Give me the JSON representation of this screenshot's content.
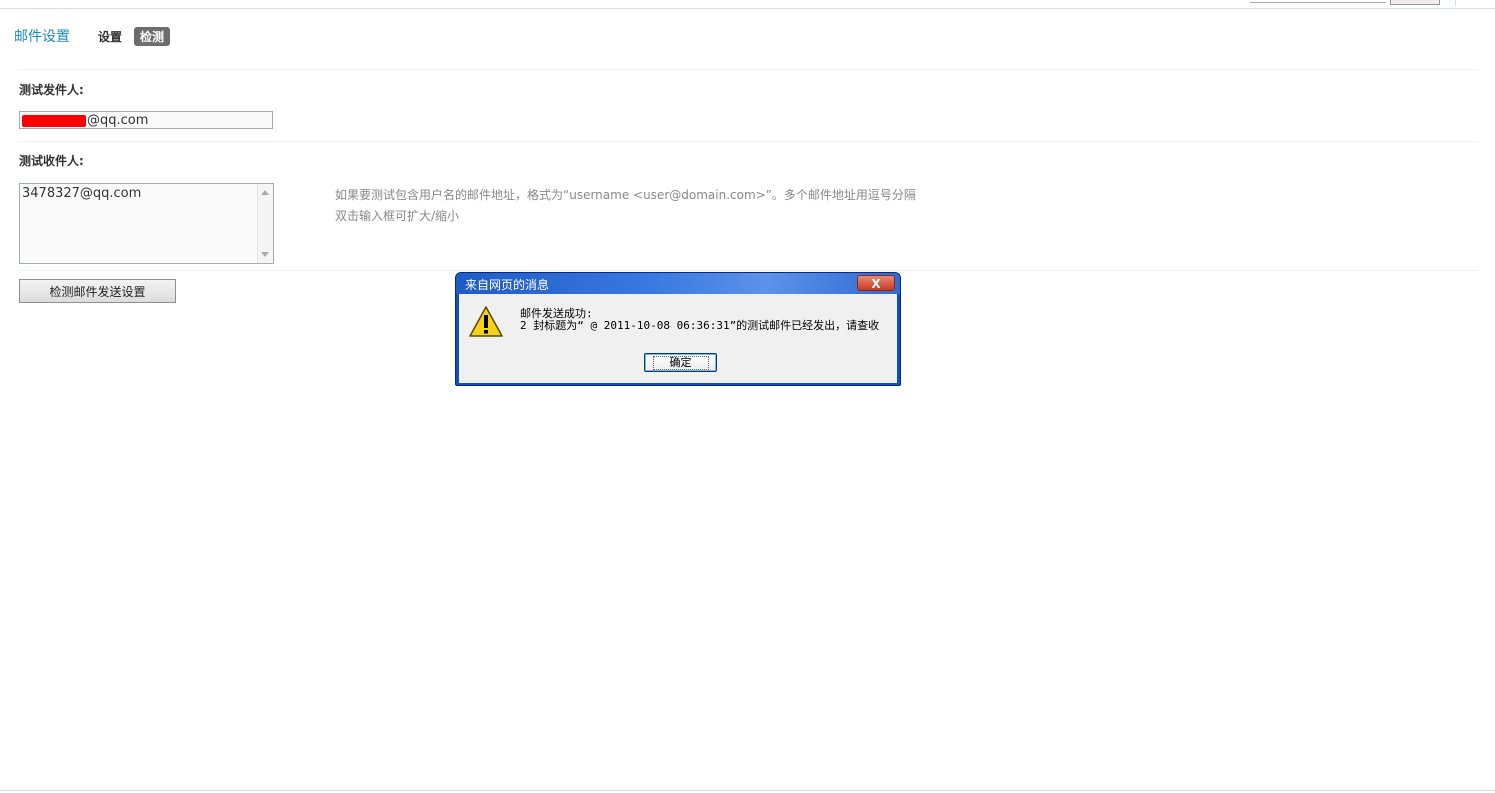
{
  "header": {
    "title": "邮件设置",
    "tabs": [
      {
        "label": "设置",
        "active": false
      },
      {
        "label": "检测",
        "active": true
      }
    ]
  },
  "form": {
    "sender_label": "测试发件人:",
    "sender_value_suffix": "@qq.com",
    "recipient_label": "测试收件人:",
    "recipient_value": "3478327@qq.com",
    "hint_line1": "如果要测试包含用户名的邮件地址，格式为“username <user@domain.com>”。多个邮件地址用逗号分隔",
    "hint_line2": "双击输入框可扩大/缩小",
    "check_button": "检测邮件发送设置"
  },
  "dialog": {
    "title": "来自网页的消息",
    "close_label": "X",
    "message_line1": "邮件发送成功:",
    "message_line2": "2 封标题为“ @ 2011-10-08 06:36:31”的测试邮件已经发出，请查收",
    "ok_label": "确定",
    "icon": "warning-icon"
  },
  "colors": {
    "title_blue": "#1b8bb4",
    "active_tab_bg": "#6d6d6d",
    "hint_gray": "#888888",
    "dialog_frame": "#0c52b8",
    "close_red": "#c63b22"
  }
}
